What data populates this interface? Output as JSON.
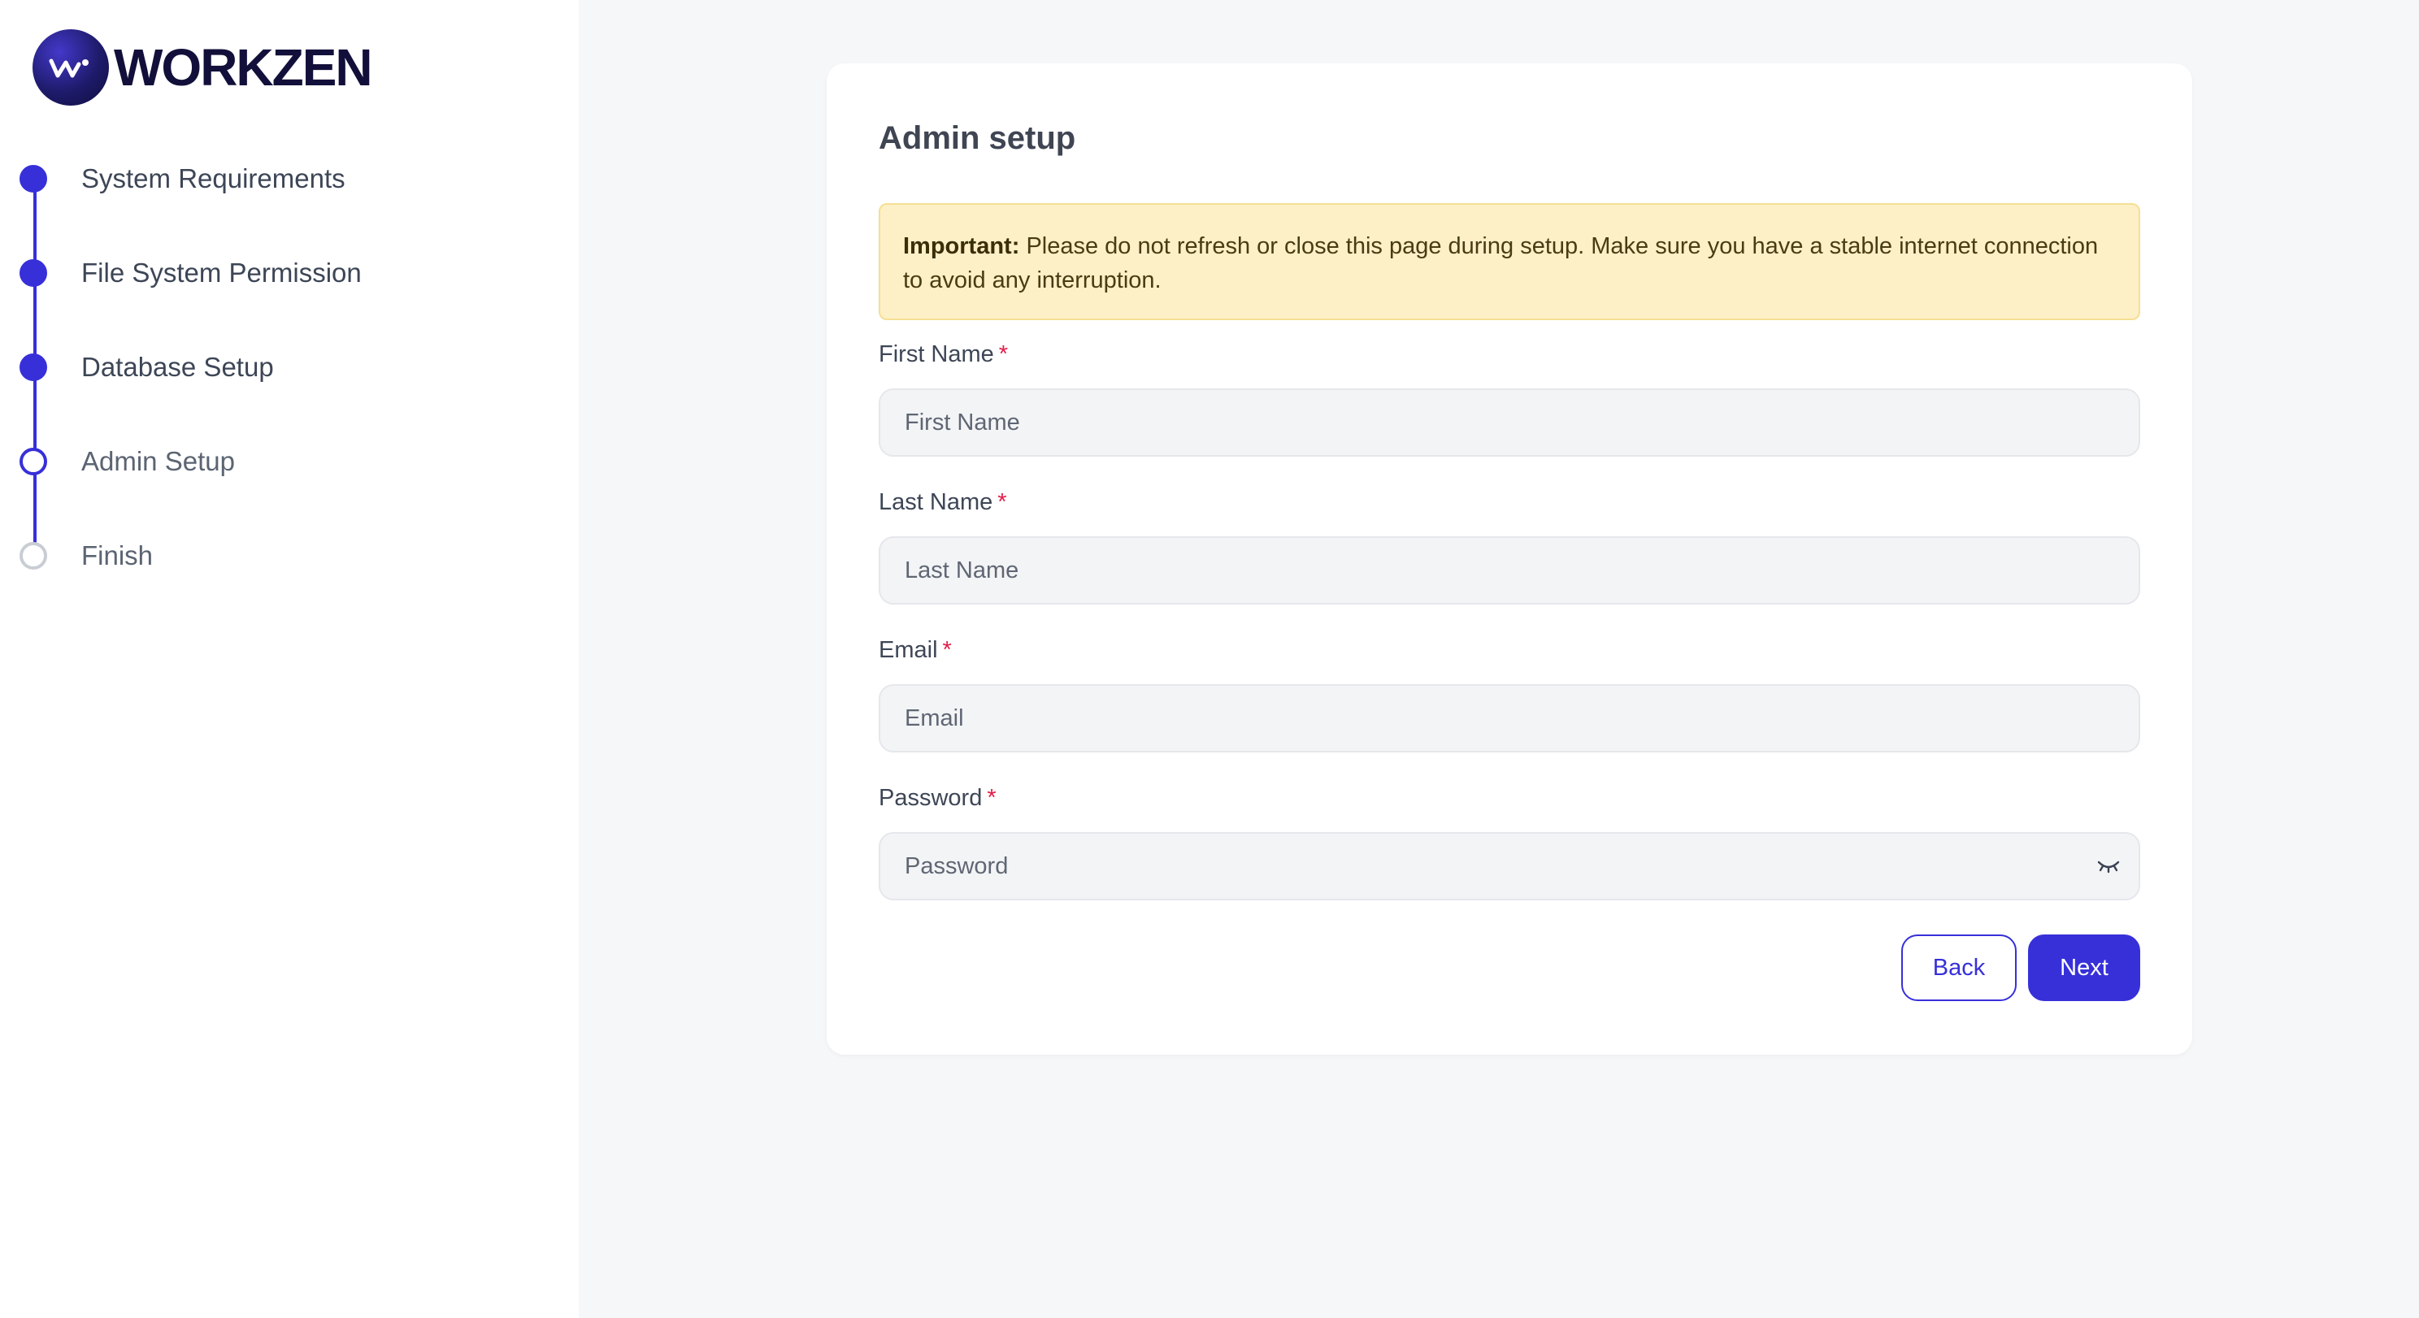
{
  "brand": {
    "name": "WORKZEN",
    "accent": "#3730d9"
  },
  "steps": [
    {
      "label": "System Requirements",
      "state": "done"
    },
    {
      "label": "File System Permission",
      "state": "done"
    },
    {
      "label": "Database Setup",
      "state": "done"
    },
    {
      "label": "Admin Setup",
      "state": "current"
    },
    {
      "label": "Finish",
      "state": "pending"
    }
  ],
  "form": {
    "title": "Admin setup",
    "alert": {
      "strong": "Important:",
      "text": "Please do not refresh or close this page during setup. Make sure you have a stable internet connection to avoid any interruption."
    },
    "fields": {
      "first_name": {
        "label": "First Name",
        "required_mark": "*",
        "placeholder": "First Name",
        "value": ""
      },
      "last_name": {
        "label": "Last Name",
        "required_mark": "*",
        "placeholder": "Last Name",
        "value": ""
      },
      "email": {
        "label": "Email",
        "required_mark": "*",
        "placeholder": "Email",
        "value": ""
      },
      "password": {
        "label": "Password",
        "required_mark": "*",
        "placeholder": "Password",
        "value": "",
        "toggle_icon": "eye-closed-icon"
      }
    },
    "buttons": {
      "back": "Back",
      "next": "Next"
    }
  }
}
